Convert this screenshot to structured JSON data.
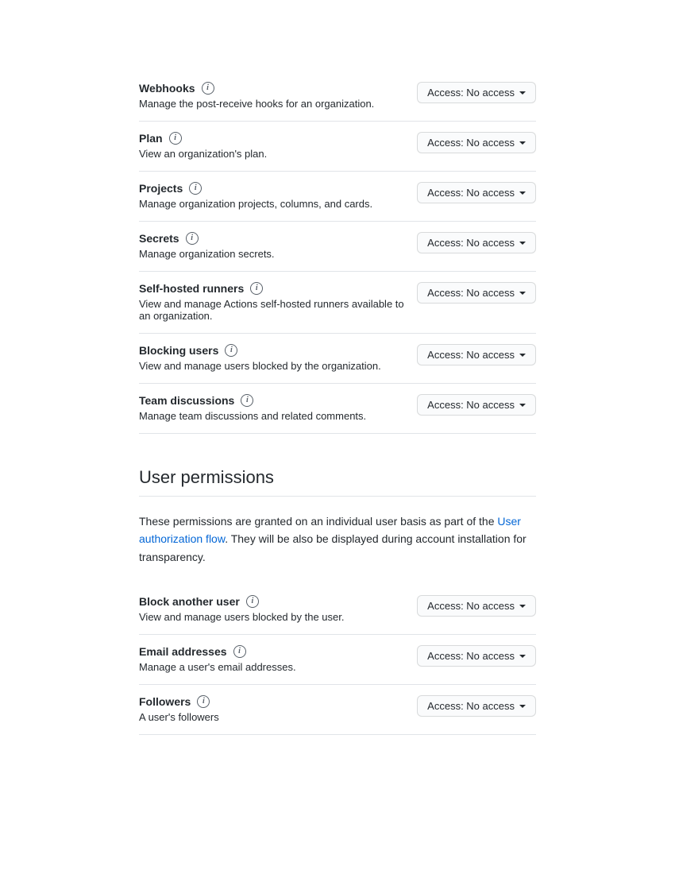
{
  "access_label": "Access: No access",
  "org_permissions": [
    {
      "title": "Webhooks",
      "desc": "Manage the post-receive hooks for an organization."
    },
    {
      "title": "Plan",
      "desc": "View an organization's plan."
    },
    {
      "title": "Projects",
      "desc": "Manage organization projects, columns, and cards."
    },
    {
      "title": "Secrets",
      "desc": "Manage organization secrets."
    },
    {
      "title": "Self-hosted runners",
      "desc": "View and manage Actions self-hosted runners available to an organization."
    },
    {
      "title": "Blocking users",
      "desc": "View and manage users blocked by the organization."
    },
    {
      "title": "Team discussions",
      "desc": "Manage team discussions and related comments."
    }
  ],
  "user_section": {
    "heading": "User permissions",
    "intro_before": "These permissions are granted on an individual user basis as part of the ",
    "intro_link": "User authorization flow",
    "intro_after": ". They will be also be displayed during account installation for transparency."
  },
  "user_permissions": [
    {
      "title": "Block another user",
      "desc": "View and manage users blocked by the user."
    },
    {
      "title": "Email addresses",
      "desc": "Manage a user's email addresses."
    },
    {
      "title": "Followers",
      "desc": "A user's followers"
    }
  ]
}
